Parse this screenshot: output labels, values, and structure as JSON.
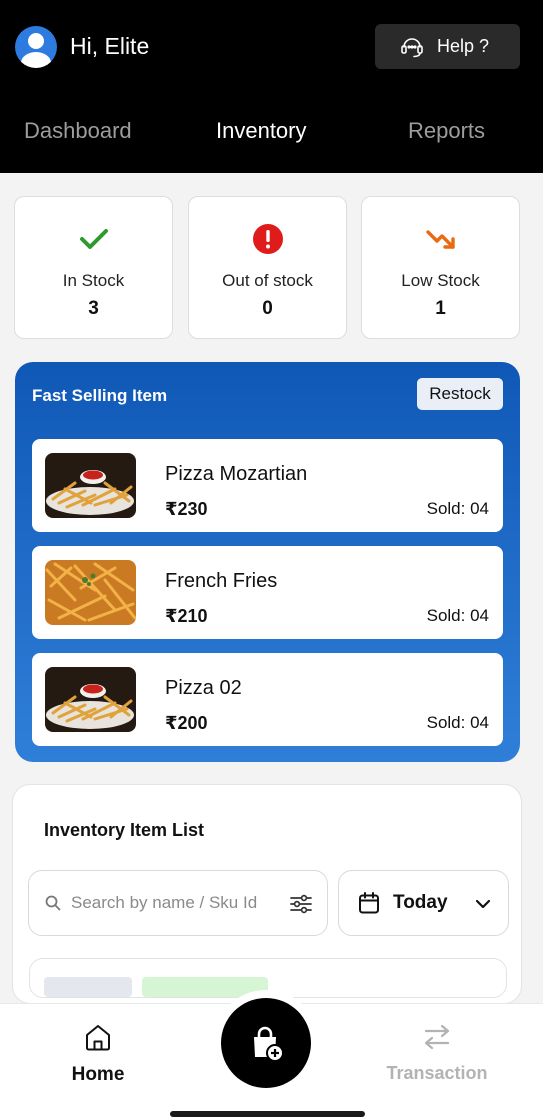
{
  "header": {
    "greeting": "Hi, Elite",
    "help_label": "Help ?"
  },
  "tabs": [
    {
      "label": "Dashboard",
      "active": false
    },
    {
      "label": "Inventory",
      "active": true
    },
    {
      "label": "Reports",
      "active": false
    }
  ],
  "stats": [
    {
      "label": "In Stock",
      "value": "3",
      "icon": "checkmark-icon",
      "color": "#2e9a2e"
    },
    {
      "label": "Out of stock",
      "value": "0",
      "icon": "alert-circle-icon",
      "color": "#e01b1b"
    },
    {
      "label": "Low Stock",
      "value": "1",
      "icon": "trending-down-icon",
      "color": "#ea6a12"
    }
  ],
  "fast_selling": {
    "title": "Fast Selling Item",
    "restock_label": "Restock",
    "items": [
      {
        "name": "Pizza Mozartian",
        "price": "₹230",
        "sold": "Sold: 04"
      },
      {
        "name": "French Fries",
        "price": "₹210",
        "sold": "Sold: 04"
      },
      {
        "name": "Pizza 02",
        "price": "₹200",
        "sold": "Sold: 04"
      }
    ]
  },
  "inventory_list": {
    "title": "Inventory Item List",
    "search_placeholder": "Search by name / Sku Id",
    "date_filter": "Today"
  },
  "bottom_nav": {
    "home_label": "Home",
    "transaction_label": "Transaction"
  },
  "colors": {
    "panel_blue_top": "#1058b6",
    "panel_blue_bottom": "#2f7fd8",
    "avatar_blue": "#2e7be0"
  }
}
